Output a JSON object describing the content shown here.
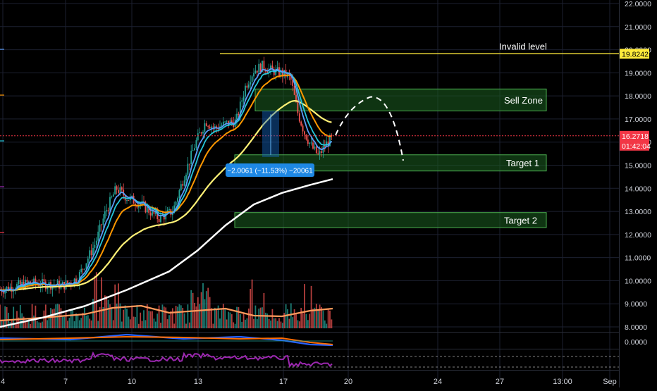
{
  "chart_data": {
    "type": "candlestick",
    "y_axis": {
      "range": [
        7.85,
        22.0
      ],
      "ticks": [
        "22.0000",
        "21.0000",
        "20.0000",
        "19.0000",
        "18.0000",
        "17.0000",
        "16.0000",
        "15.0000",
        "14.0000",
        "13.0000",
        "12.0000",
        "11.0000",
        "10.0000",
        "9.0000",
        "8.0000"
      ],
      "tick_values": [
        22,
        21,
        20,
        19,
        18,
        17,
        16,
        15,
        14,
        13,
        12,
        11,
        10,
        9,
        8
      ]
    },
    "x_axis": {
      "labels": [
        "4",
        "7",
        "10",
        "13",
        "17",
        "20",
        "24",
        "27",
        "13:00",
        "Sep"
      ]
    },
    "price_labels": {
      "invalid_level": "19.8242",
      "current_price": "16.2718",
      "countdown": "01:42:04"
    },
    "levels": {
      "invalid": 19.8242,
      "current": 16.2718
    },
    "zones": [
      {
        "label": "Sell Zone",
        "low": 17.35,
        "high": 18.3
      },
      {
        "label": "Target 1",
        "low": 14.75,
        "high": 15.45
      },
      {
        "label": "Target 2",
        "low": 12.3,
        "high": 12.95
      }
    ],
    "annotations": {
      "invalid_label": "Invalid level",
      "measure_label": "−2.0061 (−11.53%) −20061"
    },
    "oscillator_tick": "0.0000",
    "colors": {
      "background": "#000000",
      "candle_up": "#26a69a",
      "candle_down": "#ef5350",
      "zone_fill": "#1b5e20",
      "zone_border": "#4caf50",
      "invalid_line": "#ffeb3b",
      "price_tag": "#f23645",
      "ema_fast": "#5b9cf6",
      "ema_mid": "#26c6da",
      "ema_slow": "#ff9800",
      "sma_50": "#fff176",
      "sma_200": "#ffffff",
      "rsi": "#9c27b0"
    }
  }
}
